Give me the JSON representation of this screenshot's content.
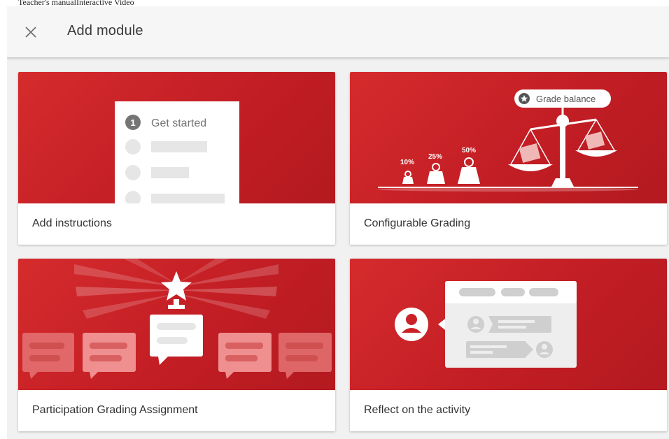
{
  "page_label": "Teacher's manualInteractive Video",
  "dialog": {
    "title": "Add module",
    "close_icon": "close-icon"
  },
  "modules": [
    {
      "label": "Add instructions",
      "illustration": {
        "step_number": "1",
        "step_text": "Get started"
      }
    },
    {
      "label": "Configurable Grading",
      "illustration": {
        "badge_text": "Grade balance",
        "weights": [
          "10%",
          "25%",
          "50%"
        ]
      }
    },
    {
      "label": "Participation Grading Assignment"
    },
    {
      "label": "Reflect on the activity"
    }
  ],
  "colors": {
    "card_red": "#c92127",
    "header_bg": "#f6f6f6",
    "dialog_bg": "#f1f1f1"
  }
}
